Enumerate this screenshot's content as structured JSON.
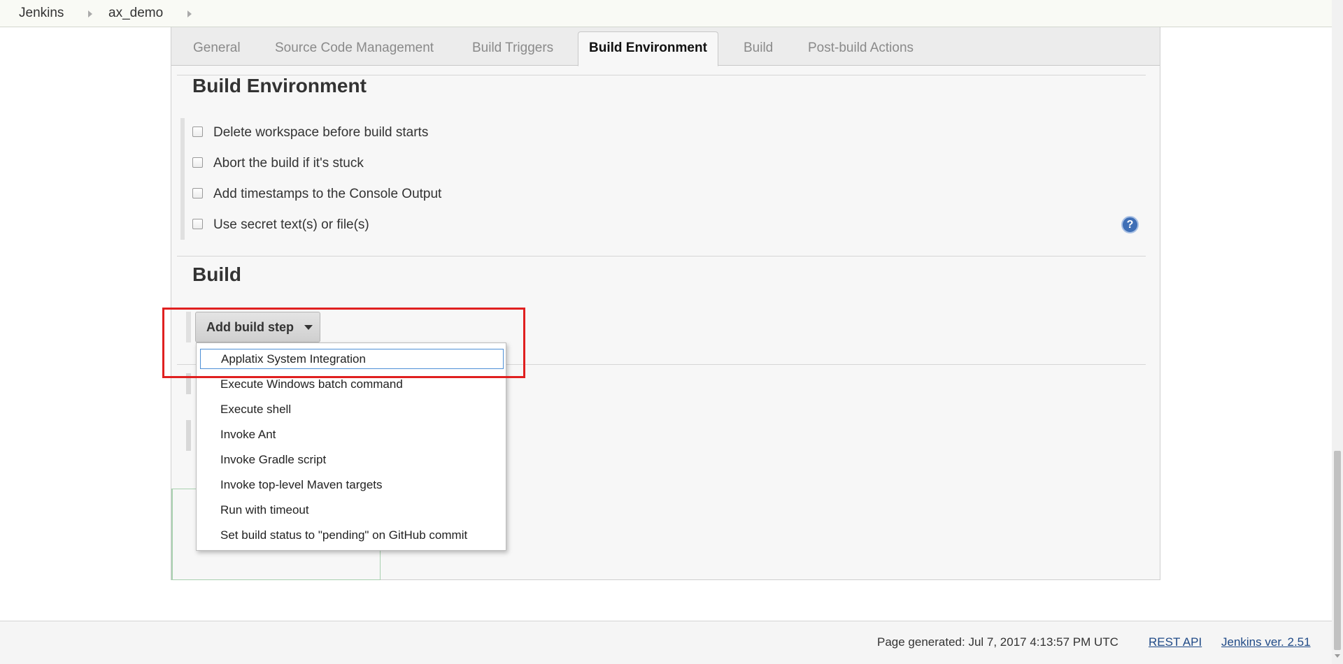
{
  "breadcrumb": {
    "items": [
      "Jenkins",
      "ax_demo"
    ]
  },
  "tabs": [
    {
      "label": "General",
      "active": false
    },
    {
      "label": "Source Code Management",
      "active": false
    },
    {
      "label": "Build Triggers",
      "active": false
    },
    {
      "label": "Build Environment",
      "active": true
    },
    {
      "label": "Build",
      "active": false
    },
    {
      "label": "Post-build Actions",
      "active": false
    }
  ],
  "build_environment": {
    "title": "Build Environment",
    "options": [
      {
        "label": "Delete workspace before build starts",
        "checked": false
      },
      {
        "label": "Abort the build if it's stuck",
        "checked": false
      },
      {
        "label": "Add timestamps to the Console Output",
        "checked": false
      },
      {
        "label": "Use secret text(s) or file(s)",
        "checked": false
      }
    ],
    "help_icon": "?"
  },
  "build": {
    "title": "Build",
    "add_step_label": "Add build step",
    "menu_items": [
      "Applatix System Integration",
      "Execute Windows batch command",
      "Execute shell",
      "Invoke Ant",
      "Invoke Gradle script",
      "Invoke top-level Maven targets",
      "Run with timeout",
      "Set build status to \"pending\" on GitHub commit"
    ],
    "focused_index": 0
  },
  "footer": {
    "generated": "Page generated: Jul 7, 2017 4:13:57 PM UTC",
    "rest_api": "REST API",
    "version": "Jenkins ver. 2.51"
  },
  "colors": {
    "highlight": "#e02020",
    "link": "#204a87",
    "focus_outline": "#4d8fd6"
  }
}
